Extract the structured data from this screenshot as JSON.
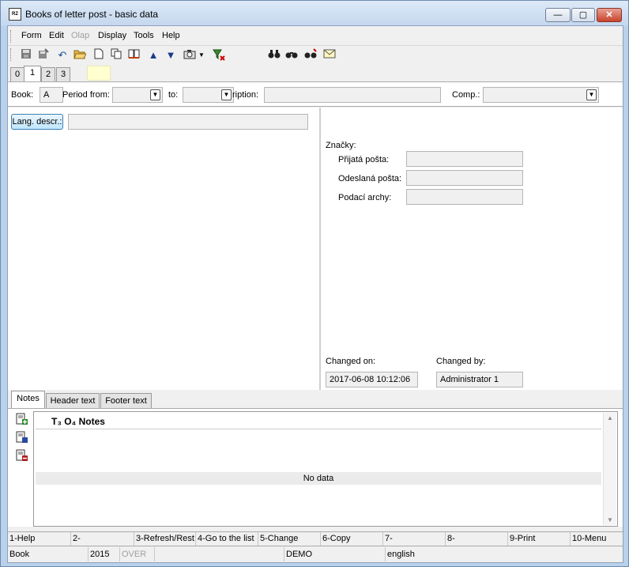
{
  "window": {
    "title": "Books of letter post - basic data",
    "app_icon_text": "RZ",
    "minimize_icon": "minimize-icon",
    "maximize_icon": "maximize-icon",
    "close_icon": "close-icon"
  },
  "menu": {
    "form": "Form",
    "edit": "Edit",
    "olap": "Olap",
    "display": "Display",
    "tools": "Tools",
    "help": "Help"
  },
  "toolbar": [
    "save-icon",
    "save-as-icon",
    "undo-icon",
    "open-folder-icon",
    "new-document-icon",
    "copy-icon",
    "book-icon",
    "arrow-up-icon",
    "arrow-down-icon",
    "camera-icon",
    "dropdown-arrow-icon",
    "filter-icon",
    "binoculars-icon",
    "find-next-icon",
    "find-replace-icon",
    "mail-icon"
  ],
  "top_tabs": [
    "0",
    "1",
    "2",
    "3"
  ],
  "filter": {
    "book_label": "Book:",
    "book_value": "A",
    "period_from_label": "Period from:",
    "period_from_value": "",
    "to_label": "to:",
    "to_value": "",
    "description_label": "ription:",
    "description_value": "",
    "comp_label": "Comp.:",
    "comp_value": ""
  },
  "left": {
    "lang_button": "Lang. descr.:",
    "lang_value": ""
  },
  "right": {
    "marks_label": "Značky:",
    "received_label": "Přijatá pošta:",
    "received_value": "",
    "sent_label": "Odeslaná pošta:",
    "sent_value": "",
    "filing_label": "Podací archy:",
    "filing_value": "",
    "changed_on_label": "Changed on:",
    "changed_on_value": "2017-06-08 10:12:06",
    "changed_by_label": "Changed by:",
    "changed_by_value": "Administrator 1"
  },
  "bottom_tabs": [
    "Notes",
    "Header text",
    "Footer text"
  ],
  "notes": {
    "header_prefix": "Т₃ О₄",
    "header": "Notes",
    "no_data": "No data",
    "side_icons": [
      "add-note-icon",
      "edit-note-icon",
      "delete-note-icon"
    ]
  },
  "fkeys": [
    "1-Help",
    "2-",
    "3-Refresh/Rest",
    "4-Go to the list",
    "5-Change",
    "6-Copy",
    "7-",
    "8-",
    "9-Print",
    "10-Menu"
  ],
  "status": {
    "module": "Book",
    "year": "2015",
    "mode": "OVER",
    "db": "DEMO",
    "language": "english"
  }
}
